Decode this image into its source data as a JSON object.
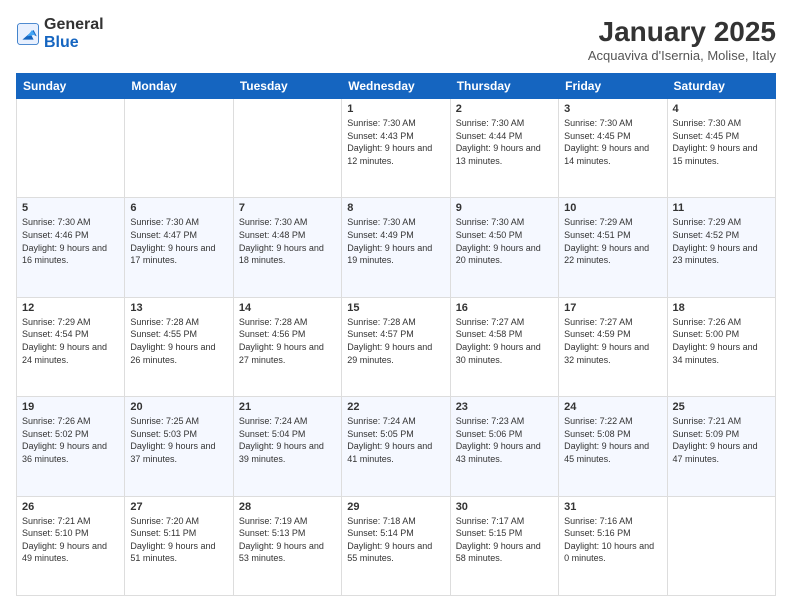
{
  "logo": {
    "line1": "General",
    "line2": "Blue"
  },
  "header": {
    "month": "January 2025",
    "location": "Acquaviva d'Isernia, Molise, Italy"
  },
  "days_of_week": [
    "Sunday",
    "Monday",
    "Tuesday",
    "Wednesday",
    "Thursday",
    "Friday",
    "Saturday"
  ],
  "weeks": [
    [
      {
        "day": "",
        "info": ""
      },
      {
        "day": "",
        "info": ""
      },
      {
        "day": "",
        "info": ""
      },
      {
        "day": "1",
        "info": "Sunrise: 7:30 AM\nSunset: 4:43 PM\nDaylight: 9 hours and 12 minutes."
      },
      {
        "day": "2",
        "info": "Sunrise: 7:30 AM\nSunset: 4:44 PM\nDaylight: 9 hours and 13 minutes."
      },
      {
        "day": "3",
        "info": "Sunrise: 7:30 AM\nSunset: 4:45 PM\nDaylight: 9 hours and 14 minutes."
      },
      {
        "day": "4",
        "info": "Sunrise: 7:30 AM\nSunset: 4:45 PM\nDaylight: 9 hours and 15 minutes."
      }
    ],
    [
      {
        "day": "5",
        "info": "Sunrise: 7:30 AM\nSunset: 4:46 PM\nDaylight: 9 hours and 16 minutes."
      },
      {
        "day": "6",
        "info": "Sunrise: 7:30 AM\nSunset: 4:47 PM\nDaylight: 9 hours and 17 minutes."
      },
      {
        "day": "7",
        "info": "Sunrise: 7:30 AM\nSunset: 4:48 PM\nDaylight: 9 hours and 18 minutes."
      },
      {
        "day": "8",
        "info": "Sunrise: 7:30 AM\nSunset: 4:49 PM\nDaylight: 9 hours and 19 minutes."
      },
      {
        "day": "9",
        "info": "Sunrise: 7:30 AM\nSunset: 4:50 PM\nDaylight: 9 hours and 20 minutes."
      },
      {
        "day": "10",
        "info": "Sunrise: 7:29 AM\nSunset: 4:51 PM\nDaylight: 9 hours and 22 minutes."
      },
      {
        "day": "11",
        "info": "Sunrise: 7:29 AM\nSunset: 4:52 PM\nDaylight: 9 hours and 23 minutes."
      }
    ],
    [
      {
        "day": "12",
        "info": "Sunrise: 7:29 AM\nSunset: 4:54 PM\nDaylight: 9 hours and 24 minutes."
      },
      {
        "day": "13",
        "info": "Sunrise: 7:28 AM\nSunset: 4:55 PM\nDaylight: 9 hours and 26 minutes."
      },
      {
        "day": "14",
        "info": "Sunrise: 7:28 AM\nSunset: 4:56 PM\nDaylight: 9 hours and 27 minutes."
      },
      {
        "day": "15",
        "info": "Sunrise: 7:28 AM\nSunset: 4:57 PM\nDaylight: 9 hours and 29 minutes."
      },
      {
        "day": "16",
        "info": "Sunrise: 7:27 AM\nSunset: 4:58 PM\nDaylight: 9 hours and 30 minutes."
      },
      {
        "day": "17",
        "info": "Sunrise: 7:27 AM\nSunset: 4:59 PM\nDaylight: 9 hours and 32 minutes."
      },
      {
        "day": "18",
        "info": "Sunrise: 7:26 AM\nSunset: 5:00 PM\nDaylight: 9 hours and 34 minutes."
      }
    ],
    [
      {
        "day": "19",
        "info": "Sunrise: 7:26 AM\nSunset: 5:02 PM\nDaylight: 9 hours and 36 minutes."
      },
      {
        "day": "20",
        "info": "Sunrise: 7:25 AM\nSunset: 5:03 PM\nDaylight: 9 hours and 37 minutes."
      },
      {
        "day": "21",
        "info": "Sunrise: 7:24 AM\nSunset: 5:04 PM\nDaylight: 9 hours and 39 minutes."
      },
      {
        "day": "22",
        "info": "Sunrise: 7:24 AM\nSunset: 5:05 PM\nDaylight: 9 hours and 41 minutes."
      },
      {
        "day": "23",
        "info": "Sunrise: 7:23 AM\nSunset: 5:06 PM\nDaylight: 9 hours and 43 minutes."
      },
      {
        "day": "24",
        "info": "Sunrise: 7:22 AM\nSunset: 5:08 PM\nDaylight: 9 hours and 45 minutes."
      },
      {
        "day": "25",
        "info": "Sunrise: 7:21 AM\nSunset: 5:09 PM\nDaylight: 9 hours and 47 minutes."
      }
    ],
    [
      {
        "day": "26",
        "info": "Sunrise: 7:21 AM\nSunset: 5:10 PM\nDaylight: 9 hours and 49 minutes."
      },
      {
        "day": "27",
        "info": "Sunrise: 7:20 AM\nSunset: 5:11 PM\nDaylight: 9 hours and 51 minutes."
      },
      {
        "day": "28",
        "info": "Sunrise: 7:19 AM\nSunset: 5:13 PM\nDaylight: 9 hours and 53 minutes."
      },
      {
        "day": "29",
        "info": "Sunrise: 7:18 AM\nSunset: 5:14 PM\nDaylight: 9 hours and 55 minutes."
      },
      {
        "day": "30",
        "info": "Sunrise: 7:17 AM\nSunset: 5:15 PM\nDaylight: 9 hours and 58 minutes."
      },
      {
        "day": "31",
        "info": "Sunrise: 7:16 AM\nSunset: 5:16 PM\nDaylight: 10 hours and 0 minutes."
      },
      {
        "day": "",
        "info": ""
      }
    ]
  ]
}
